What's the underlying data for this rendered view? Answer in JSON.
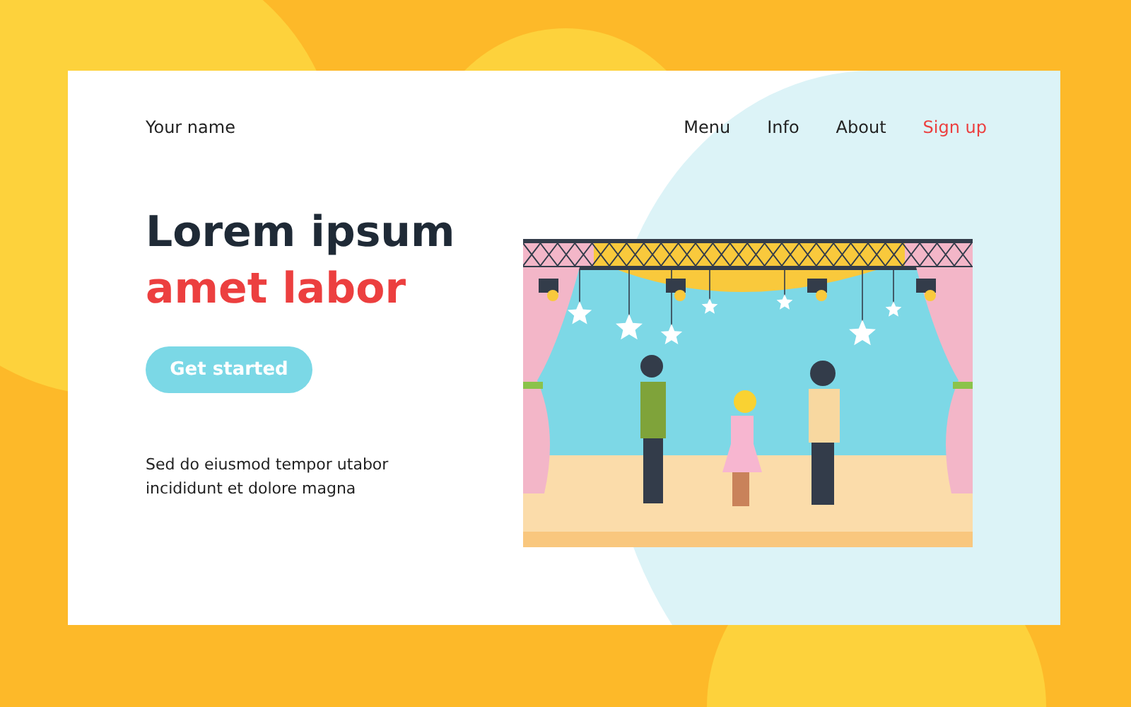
{
  "brand": "Your name",
  "nav": [
    {
      "label": "Menu",
      "kind": "link"
    },
    {
      "label": "Info",
      "kind": "link"
    },
    {
      "label": "About",
      "kind": "link"
    },
    {
      "label": "Sign up",
      "kind": "accent"
    }
  ],
  "hero": {
    "title_line_1": "Lorem ipsum",
    "title_line_2": "amet labor",
    "button": "Get started",
    "text": "Sed do eiusmod tempor utabor incididunt et dolore magna"
  }
}
